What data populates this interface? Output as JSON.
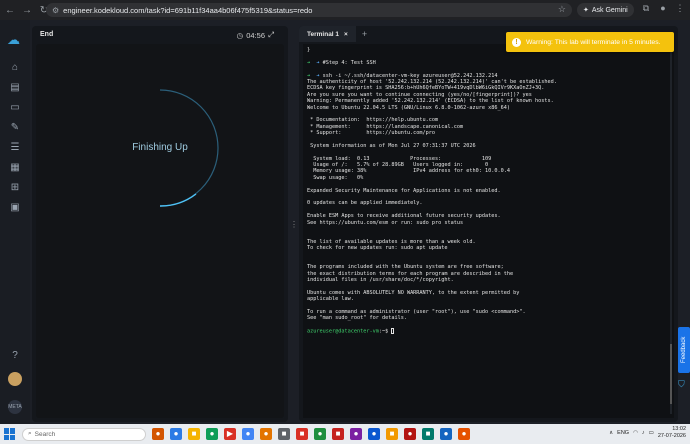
{
  "browser": {
    "url": "engineer.kodekloud.com/task?id=691b11f34aa4b06f475f5319&status=redo",
    "gemini_label": "Ask Gemini"
  },
  "left_panel": {
    "title": "End",
    "timer": "04:56",
    "status_text": "Finishing Up"
  },
  "toast": {
    "message": "Warning: This lab will terminate in 5 minutes."
  },
  "terminal": {
    "tab_label": "Terminal 1",
    "lines": [
      "}",
      "",
      "➜  ➜ #Step 4: Test SSH",
      "",
      "➜  ➜ ssh -i ~/.ssh/datacenter-vm-key azureuser@52.242.132.214",
      "The authenticity of host '52.242.132.214 (52.242.132.214)' can't be established.",
      "ECDSA key fingerprint is SHA256:b+hUh6QfeBYoTW+419vqDlbW6iGkQIVr9KXaOnZJ+3Q.",
      "Are you sure you want to continue connecting (yes/no/[fingerprint])? yes",
      "Warning: Permanently added '52.242.132.214' (ECDSA) to the list of known hosts.",
      "Welcome to Ubuntu 22.04.5 LTS (GNU/Linux 6.8.0-1062-azure x86_64)",
      "",
      " * Documentation:  https://help.ubuntu.com",
      " * Management:     https://landscape.canonical.com",
      " * Support:        https://ubuntu.com/pro",
      "",
      " System information as of Mon Jul 27 07:31:37 UTC 2026",
      "",
      "  System load:  0.13             Processes:             109",
      "  Usage of /:   5.7% of 28.89GB   Users logged in:       0",
      "  Memory usage: 38%               IPv4 address for eth0: 10.0.0.4",
      "  Swap usage:   0%",
      "",
      "Expanded Security Maintenance for Applications is not enabled.",
      "",
      "0 updates can be applied immediately.",
      "",
      "Enable ESM Apps to receive additional future security updates.",
      "See https://ubuntu.com/esm or run: sudo pro status",
      "",
      "",
      "The list of available updates is more than a week old.",
      "To check for new updates run: sudo apt update",
      "",
      "",
      "The programs included with the Ubuntu system are free software;",
      "the exact distribution terms for each program are described in the",
      "individual files in /usr/share/doc/*/copyright.",
      "",
      "Ubuntu comes with ABSOLUTELY NO WARRANTY, to the extent permitted by",
      "applicable law.",
      "",
      "To run a command as administrator (user \"root\"), use \"sudo <command>\".",
      "See \"man sudo_root\" for details.",
      ""
    ],
    "prompt_user": "azureuser@datacenter-vm",
    "prompt_suffix": ":~$ "
  },
  "feedback_label": "Feedback",
  "taskbar": {
    "search_placeholder": "Search",
    "language": "ENG",
    "time": "13:02",
    "date": "27-07-2026"
  }
}
